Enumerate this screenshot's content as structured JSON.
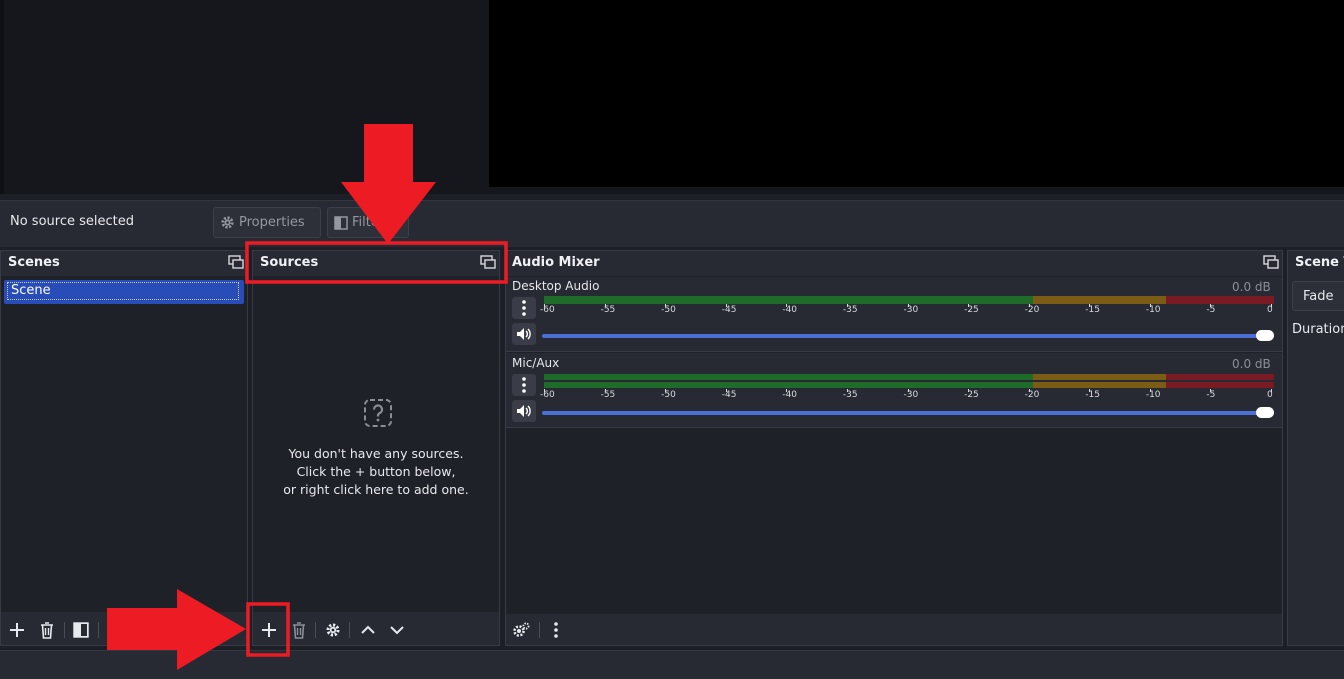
{
  "context": {
    "no_source_label": "No source selected",
    "properties_label": "Properties",
    "filters_label": "Filters"
  },
  "scenes": {
    "title": "Scenes",
    "items": [
      {
        "label": "Scene",
        "selected": true
      }
    ]
  },
  "sources": {
    "title": "Sources",
    "empty_line1": "You don't have any sources.",
    "empty_line2": "Click the + button below,",
    "empty_line3": "or right click here to add one."
  },
  "audio": {
    "title": "Audio Mixer",
    "ticks": [
      "-60",
      "-55",
      "-50",
      "-45",
      "-40",
      "-35",
      "-30",
      "-25",
      "-20",
      "-15",
      "-10",
      "-5",
      "0"
    ],
    "channels": [
      {
        "name": "Desktop Audio",
        "db": "0.0 dB",
        "volume": 1.0
      },
      {
        "name": "Mic/Aux",
        "db": "0.0 dB",
        "volume": 1.0
      }
    ],
    "colors": {
      "green": "#1e6b2a",
      "yellow": "#7a5c14",
      "red": "#7a1a22",
      "slider": "#4a6fd6"
    }
  },
  "transitions": {
    "title": "Scene T",
    "fade_label": "Fade",
    "duration_label": "Duration"
  },
  "annotation": {
    "color": "#ed1c24"
  }
}
